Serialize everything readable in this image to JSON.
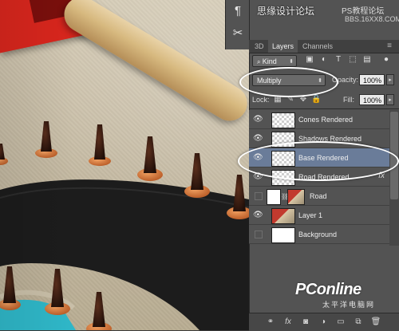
{
  "watermark": {
    "site_cn": "思缘设计论坛",
    "site_tag": "PS教程论坛",
    "site_url": "BBS.16XX8.COM"
  },
  "panel": {
    "tabs": [
      {
        "label": "3D"
      },
      {
        "label": "Layers"
      },
      {
        "label": "Channels"
      }
    ],
    "filter_kind": "Kind",
    "blend_mode": "Multiply",
    "opacity_label": "Opacity:",
    "opacity_value": "100%",
    "lock_label": "Lock:",
    "fill_label": "Fill:",
    "fill_value": "100%",
    "layers": [
      {
        "name": "Cones Rendered",
        "visible": true
      },
      {
        "name": "Shadows Rendered",
        "visible": true
      },
      {
        "name": "Base Rendered",
        "visible": true,
        "selected": true
      },
      {
        "name": "Road Rendered",
        "visible": true,
        "fx": "fx"
      },
      {
        "name": "Road",
        "visible": false
      },
      {
        "name": "Layer 1",
        "visible": true
      },
      {
        "name": "Background",
        "visible": false
      }
    ],
    "bottom_icons": [
      "link-icon",
      "fx-icon",
      "mask-icon",
      "adjustment-icon",
      "folder-icon",
      "new-layer-icon",
      "trash-icon"
    ]
  },
  "logo": {
    "main": "PConline",
    "sub": "太平洋电脑网"
  },
  "colors": {
    "panel_bg": "#535353",
    "selected_layer": "#6a7c99",
    "road": "#1e1e1e",
    "cone": "#3a1d12",
    "cone_base": "#d9773a"
  }
}
